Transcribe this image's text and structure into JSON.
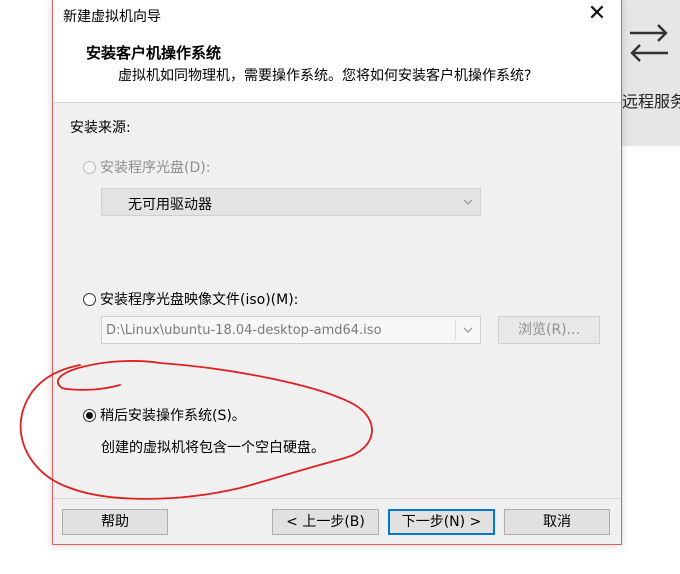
{
  "background_app": {
    "label": "远程服务",
    "icon": "swap-arrows-icon"
  },
  "dialog": {
    "title": "新建虚拟机向导",
    "close_icon": "close-icon",
    "header_title": "安装客户机操作系统",
    "header_subtitle": "虚拟机如同物理机，需要操作系统。您将如何安装客户机操作系统?",
    "source_label": "安装来源:",
    "options": {
      "disc": {
        "label": "安装程序光盘(D):",
        "selected": false,
        "enabled": false
      },
      "disc_drive": {
        "value": "无可用驱动器"
      },
      "iso": {
        "label": "安装程序光盘映像文件(iso)(M):",
        "selected": false,
        "enabled": true
      },
      "iso_path": {
        "value": "D:\\Linux\\ubuntu-18.04-desktop-amd64.iso"
      },
      "browse": {
        "label": "浏览(R)..."
      },
      "later": {
        "label": "稍后安装操作系统(S)。",
        "selected": true,
        "enabled": true
      }
    },
    "description": "创建的虚拟机将包含一个空白硬盘。",
    "buttons": {
      "help": "帮助",
      "back": "< 上一步(B)",
      "next": "下一步(N) >",
      "cancel": "取消"
    },
    "annotation_color": "#e02020"
  }
}
